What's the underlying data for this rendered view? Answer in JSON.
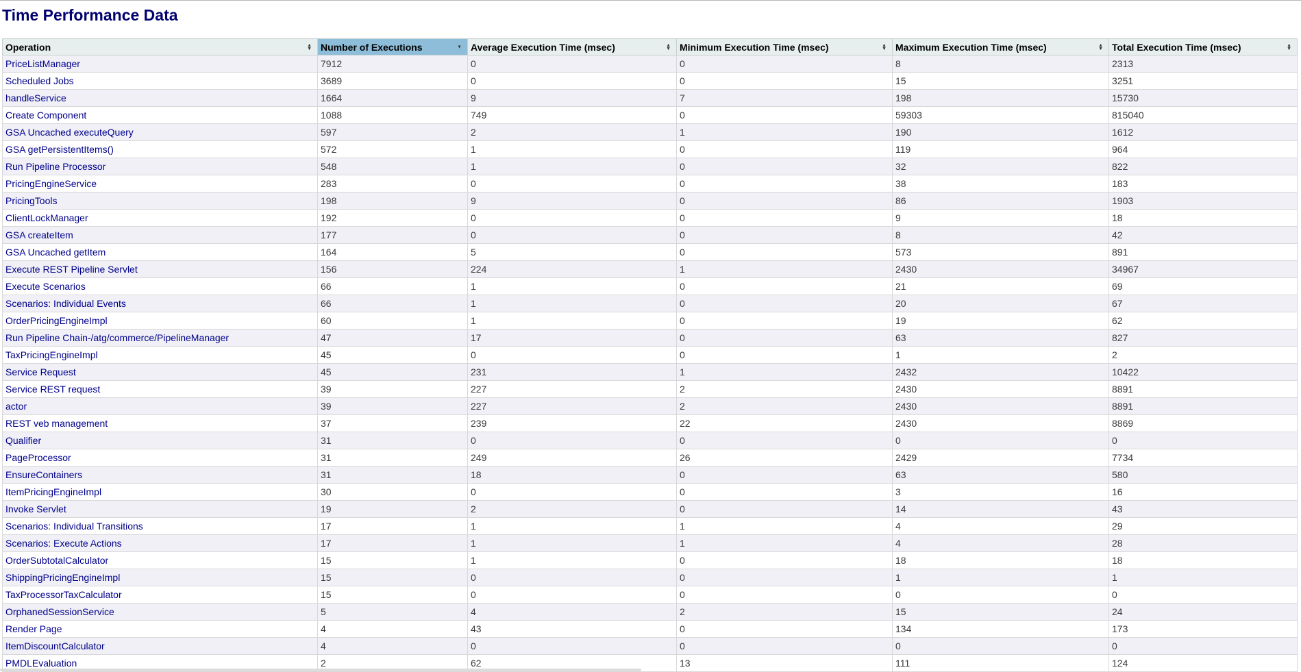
{
  "page": {
    "title": "Time Performance Data"
  },
  "table": {
    "columns": [
      "Operation",
      "Number of Executions",
      "Average Execution Time (msec)",
      "Minimum Execution Time (msec)",
      "Maximum Execution Time (msec)",
      "Total Execution Time (msec)"
    ],
    "sorted_column": 1,
    "sort_icons": {
      "both": "sort-up-down-icon",
      "desc": "sort-desc-icon"
    },
    "rows": [
      [
        "PriceListManager",
        "7912",
        "0",
        "0",
        "8",
        "2313"
      ],
      [
        "Scheduled Jobs",
        "3689",
        "0",
        "0",
        "15",
        "3251"
      ],
      [
        "handleService",
        "1664",
        "9",
        "7",
        "198",
        "15730"
      ],
      [
        "Create Component",
        "1088",
        "749",
        "0",
        "59303",
        "815040"
      ],
      [
        "GSA Uncached executeQuery",
        "597",
        "2",
        "1",
        "190",
        "1612"
      ],
      [
        "GSA getPersistentItems()",
        "572",
        "1",
        "0",
        "119",
        "964"
      ],
      [
        "Run Pipeline Processor",
        "548",
        "1",
        "0",
        "32",
        "822"
      ],
      [
        "PricingEngineService",
        "283",
        "0",
        "0",
        "38",
        "183"
      ],
      [
        "PricingTools",
        "198",
        "9",
        "0",
        "86",
        "1903"
      ],
      [
        "ClientLockManager",
        "192",
        "0",
        "0",
        "9",
        "18"
      ],
      [
        "GSA createItem",
        "177",
        "0",
        "0",
        "8",
        "42"
      ],
      [
        "GSA Uncached getItem",
        "164",
        "5",
        "0",
        "573",
        "891"
      ],
      [
        "Execute REST Pipeline Servlet",
        "156",
        "224",
        "1",
        "2430",
        "34967"
      ],
      [
        "Execute Scenarios",
        "66",
        "1",
        "0",
        "21",
        "69"
      ],
      [
        "Scenarios: Individual Events",
        "66",
        "1",
        "0",
        "20",
        "67"
      ],
      [
        "OrderPricingEngineImpl",
        "60",
        "1",
        "0",
        "19",
        "62"
      ],
      [
        "Run Pipeline Chain-/atg/commerce/PipelineManager",
        "47",
        "17",
        "0",
        "63",
        "827"
      ],
      [
        "TaxPricingEngineImpl",
        "45",
        "0",
        "0",
        "1",
        "2"
      ],
      [
        "Service Request",
        "45",
        "231",
        "1",
        "2432",
        "10422"
      ],
      [
        "Service REST request",
        "39",
        "227",
        "2",
        "2430",
        "8891"
      ],
      [
        "actor",
        "39",
        "227",
        "2",
        "2430",
        "8891"
      ],
      [
        "REST          veb management",
        "37",
        "239",
        "22",
        "2430",
        "8869"
      ],
      [
        "Qualifier",
        "31",
        "0",
        "0",
        "0",
        "0"
      ],
      [
        "PageProcessor",
        "31",
        "249",
        "26",
        "2429",
        "7734"
      ],
      [
        "EnsureContainers",
        "31",
        "18",
        "0",
        "63",
        "580"
      ],
      [
        "ItemPricingEngineImpl",
        "30",
        "0",
        "0",
        "3",
        "16"
      ],
      [
        "Invoke Servlet",
        "19",
        "2",
        "0",
        "14",
        "43"
      ],
      [
        "Scenarios: Individual Transitions",
        "17",
        "1",
        "1",
        "4",
        "29"
      ],
      [
        "Scenarios: Execute Actions",
        "17",
        "1",
        "1",
        "4",
        "28"
      ],
      [
        "OrderSubtotalCalculator",
        "15",
        "1",
        "0",
        "18",
        "18"
      ],
      [
        "ShippingPricingEngineImpl",
        "15",
        "0",
        "0",
        "1",
        "1"
      ],
      [
        "TaxProcessorTaxCalculator",
        "15",
        "0",
        "0",
        "0",
        "0"
      ],
      [
        "OrphanedSessionService",
        "5",
        "4",
        "2",
        "15",
        "24"
      ],
      [
        "Render Page",
        "4",
        "43",
        "0",
        "134",
        "173"
      ],
      [
        "ItemDiscountCalculator",
        "4",
        "0",
        "0",
        "0",
        "0"
      ],
      [
        "PMDLEvaluation",
        "2",
        "62",
        "13",
        "111",
        "124"
      ]
    ]
  }
}
